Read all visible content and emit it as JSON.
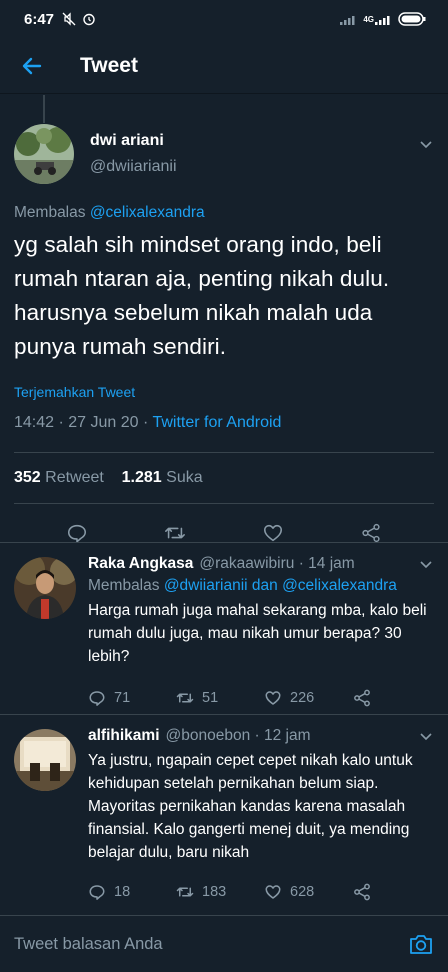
{
  "status_bar": {
    "time": "6:47",
    "network": "4G"
  },
  "header": {
    "title": "Tweet"
  },
  "main_tweet": {
    "author_name": "dwi ariani",
    "author_handle": "@dwiiarianii",
    "replying_prefix": "Membalas",
    "replying_to": "@celixalexandra",
    "text": "yg salah sih mindset orang indo, beli rumah ntaran aja, penting nikah dulu. harusnya sebelum nikah malah uda punya rumah sendiri.",
    "translate": "Terjemahkan Tweet",
    "timestamp": "14:42 · 27 Jun 20 · ",
    "source": "Twitter for Android",
    "retweet_count": "352",
    "retweet_label": "Retweet",
    "like_count": "1.281",
    "like_label": "Suka"
  },
  "replies": [
    {
      "name": "Raka Angkasa",
      "handle": "@rakaawibiru",
      "time": "· 14 jam",
      "replying_prefix": "Membalas",
      "replying_to": "@dwiiarianii dan @celixalexandra",
      "text": "Harga rumah juga mahal sekarang mba, kalo beli rumah dulu juga, mau nikah umur berapa? 30 lebih?",
      "replies": "71",
      "retweets": "51",
      "likes": "226"
    },
    {
      "name": "alfihikami",
      "handle": "@bonoebon",
      "time": "· 12 jam",
      "text": "Ya justru, ngapain cepet cepet nikah kalo untuk kehidupan setelah pernikahan belum siap. Mayoritas pernikahan kandas karena masalah finansial. Kalo gangerti menej duit, ya mending belajar dulu, baru nikah",
      "replies": "18",
      "retweets": "183",
      "likes": "628"
    }
  ],
  "compose": {
    "placeholder": "Tweet balasan Anda"
  },
  "colors": {
    "background": "#15202b",
    "accent": "#1da1f2",
    "muted": "#8899a6",
    "divider": "#38444d"
  }
}
